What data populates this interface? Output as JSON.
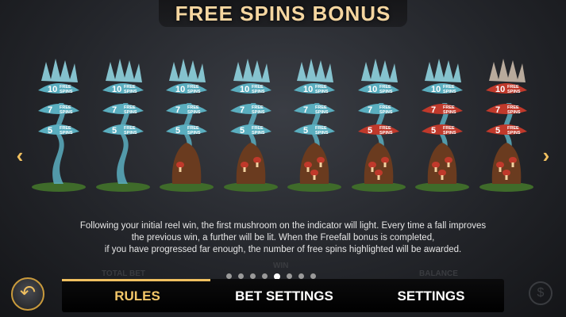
{
  "title": "FREE SPINS BONUS",
  "stages": [
    {
      "lit": 0,
      "labels": [
        "10",
        "FREE",
        "SPINS",
        "7",
        "FREE",
        "SPINS",
        "5",
        "FREE",
        "SPINS"
      ]
    },
    {
      "lit": 0,
      "labels": [
        "10",
        "FREE",
        "SPINS",
        "7",
        "FREE",
        "SPINS",
        "5",
        "FREE",
        "SPINS"
      ]
    },
    {
      "lit": 1,
      "labels": [
        "10",
        "FREE",
        "SPINS",
        "7",
        "FREE",
        "SPINS",
        "5",
        "FREE",
        "SPINS"
      ]
    },
    {
      "lit": 2,
      "labels": [
        "10",
        "FREE",
        "SPINS",
        "7",
        "FREE",
        "SPINS",
        "5",
        "FREE",
        "SPINS"
      ]
    },
    {
      "lit": 3,
      "labels": [
        "10",
        "FREE",
        "SPINS",
        "7",
        "FREE",
        "SPINS",
        "5",
        "FREE",
        "SPINS"
      ]
    },
    {
      "lit": 4,
      "labels": [
        "10",
        "FREE",
        "SPINS",
        "7",
        "FREE",
        "SPINS",
        "5",
        "FREE",
        "SPINS"
      ]
    },
    {
      "lit": 5,
      "labels": [
        "10",
        "FREE",
        "SPINS",
        "7",
        "FREE",
        "SPINS",
        "5",
        "FREE",
        "SPINS"
      ]
    },
    {
      "lit": 6,
      "labels": [
        "10",
        "FREE",
        "SPINS",
        "7",
        "FREE",
        "SPINS",
        "5",
        "FREE",
        "SPINS"
      ]
    }
  ],
  "description": [
    "Following your initial reel win, the first mushroom on the indicator will light. Every time a fall improves",
    "the previous win, a further will be lit. When the Freefall bonus is completed,",
    "if you have progressed far enough, the number of free spins highlighted will be awarded."
  ],
  "pagination": {
    "count": 8,
    "active": 4
  },
  "background_labels": {
    "total_bet": "TOTAL BET",
    "win": "WIN",
    "balance": "BALANCE"
  },
  "menu": {
    "rules": "RULES",
    "bet_settings": "BET SETTINGS",
    "settings": "SETTINGS"
  },
  "icons": {
    "prev": "chevron-left-icon",
    "next": "chevron-right-icon",
    "back": "back-arrow-icon",
    "coin": "coin-icon"
  },
  "colors": {
    "accent": "#f0c060",
    "title": "#f5d6a0",
    "crystal": "#5aaebf",
    "mushroom": "#c0392b"
  }
}
